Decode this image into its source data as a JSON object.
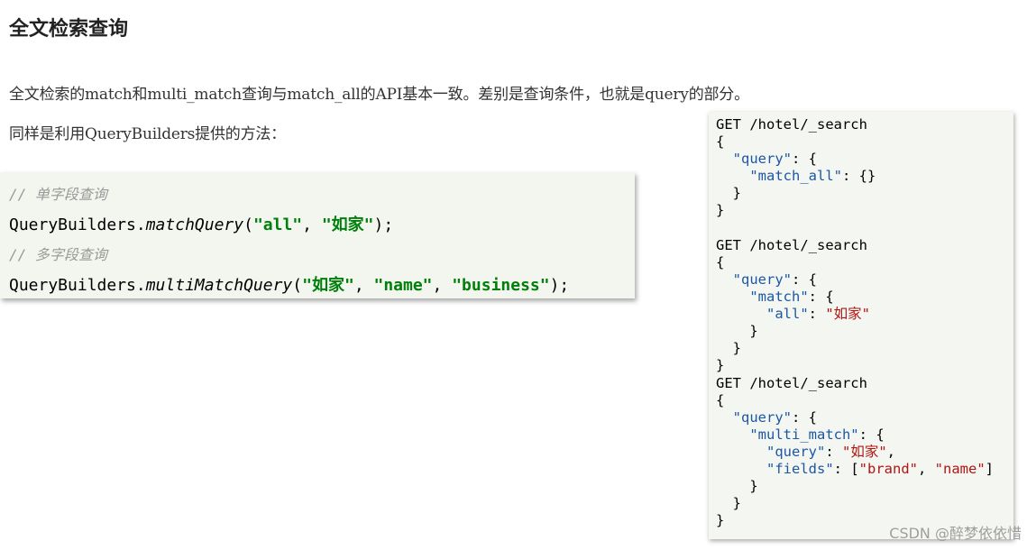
{
  "heading": "全文检索查询",
  "paragraph1": "全文检索的match和multi_match查询与match_all的API基本一致。差别是查询条件，也就是query的部分。",
  "paragraph2": "同样是利用QueryBuilders提供的方法：",
  "java_code": {
    "comment1": "// 单字段查询",
    "line1": {
      "obj": "QueryBuilders.",
      "method": "matchQuery",
      "open": "(",
      "arg1": "\"all\"",
      "sep1": ", ",
      "arg2": "\"如家\"",
      "close": ");"
    },
    "comment2": "// 多字段查询",
    "line2": {
      "obj": "QueryBuilders.",
      "method": "multiMatchQuery",
      "open": "(",
      "arg1": "\"如家\"",
      "sep1": ", ",
      "arg2": "\"name\"",
      "sep2": ", ",
      "arg3": "\"business\"",
      "close": ");"
    }
  },
  "json_code": {
    "get1": "GET /hotel/_search",
    "get2": "GET /hotel/_search",
    "get3": "GET /hotel/_search",
    "k_query": "\"query\"",
    "k_match_all": "\"match_all\"",
    "k_match": "\"match\"",
    "k_all": "\"all\"",
    "v_rujia": "\"如家\"",
    "k_multi_match": "\"multi_match\"",
    "k_fields": "\"fields\"",
    "v_brand": "\"brand\"",
    "v_name": "\"name\""
  },
  "watermark": "CSDN @醉梦依依惜"
}
